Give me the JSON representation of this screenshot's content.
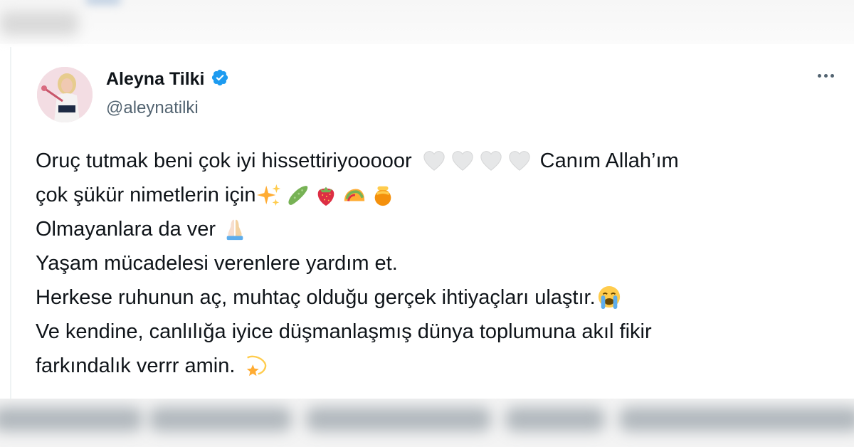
{
  "author": {
    "display_name": "Aleyna Tilki",
    "handle": "@aleynatilki",
    "verified": true
  },
  "icons": {
    "verified": "verified-badge-icon",
    "more": "more-options-icon"
  },
  "colors": {
    "text_primary": "#0f1419",
    "text_secondary": "#536471",
    "verified_blue": "#1d9bf0"
  },
  "tweet": {
    "line1_a": "Oruç tutmak beni çok iyi hissettiriyooooor",
    "line1_b": "Canım Allah’ım",
    "line2": "çok şükür nimetlerin için",
    "line3": "Olmayanlara da ver",
    "line4": "Yaşam mücadelesi verenlere yardım et.",
    "line5": "Herkese ruhunun aç, muhtaç olduğu gerçek ihtiyaçları ulaştır.",
    "line6": "Ve kendine, canlılığa iyice düşmanlaşmış dünya toplumuna akıl fikir",
    "line7": "farkındalık verrr amin.",
    "emoji": {
      "line1": [
        "white-heart",
        "white-heart",
        "white-heart",
        "white-heart"
      ],
      "line2": [
        "sparkles",
        "cucumber",
        "strawberry",
        "taco",
        "honey-pot"
      ],
      "line3": [
        "folded-hands"
      ],
      "line5": [
        "loudly-crying-face"
      ],
      "line7": [
        "dizzy-star"
      ]
    }
  }
}
